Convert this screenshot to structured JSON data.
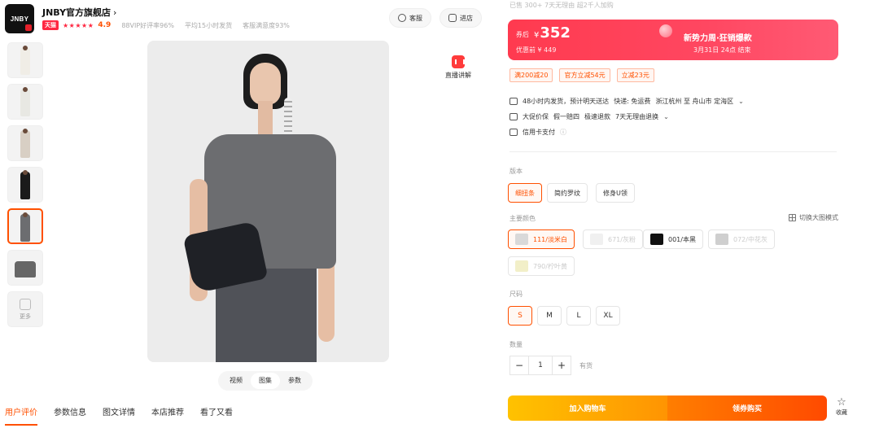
{
  "store": {
    "logo_text": "JNBY",
    "name": "JNBY官方旗舰店",
    "chevron": "›",
    "tmall_badge": "天猫",
    "stars": "★★★★★",
    "rating": "4.9",
    "stats": [
      "88VIP好评率96%",
      "平均15小时发货",
      "客服满意度93%"
    ]
  },
  "header_buttons": {
    "service": "客服",
    "shop": "进店"
  },
  "live": {
    "label": "直播讲解"
  },
  "thumbnails": {
    "more_label": "更多",
    "items": [
      {
        "kind": "model",
        "color": "#f0ede6"
      },
      {
        "kind": "model",
        "color": "#f2f2f0"
      },
      {
        "kind": "model",
        "color": "#efece4"
      },
      {
        "kind": "model",
        "color": "#1a1a1a"
      },
      {
        "kind": "model",
        "color": "#6c6d70",
        "active": true
      },
      {
        "kind": "tee",
        "color": "#5d5e61"
      }
    ]
  },
  "view_tabs": [
    "视频",
    "图集",
    "参数"
  ],
  "view_tab_active": 1,
  "bottom_tabs": [
    "用户评价",
    "参数信息",
    "图文详情",
    "本店推荐",
    "看了又看"
  ],
  "bottom_tab_active": 0,
  "price": {
    "top_partial": "已售 300+ 7天无理由 超2千人加购",
    "label": "券后",
    "currency": "¥",
    "value": "352",
    "sub": "优惠前 ¥ 449",
    "promo_title": "新势力周·狂销爆款",
    "promo_time": "3月31日 24点 结束"
  },
  "coupons": [
    "满200减20",
    "官方立减54元",
    "立减23元"
  ],
  "services": [
    {
      "icon": "truck-icon",
      "text": "48小时内发货，预计明天送达",
      "extra": "快递: 免运费",
      "route": "浙江杭州 至 舟山市 定海区",
      "chevron": "⌄"
    },
    {
      "icon": "shield-icon",
      "text": "大促价保",
      "extra": "假一赔四",
      "route": "极速退款",
      "extra2": "7天无理由退换",
      "chevron": "⌄"
    },
    {
      "icon": "card-icon",
      "text": "信用卡支付",
      "info": "ⓘ"
    }
  ],
  "version": {
    "label": "版本",
    "options": [
      "细扭条",
      "简约罗纹",
      "修身U领"
    ],
    "selected": 0
  },
  "color": {
    "label": "主要颜色",
    "toggle": "切换大图模式",
    "options": [
      {
        "label": "111/淡米白",
        "swatch": "#d9d9d9",
        "state": "selected"
      },
      {
        "label": "671/灰粉",
        "swatch": "#f0f0f0",
        "state": "disabled"
      },
      {
        "label": "001/本黑",
        "swatch": "#111111",
        "state": "normal"
      },
      {
        "label": "072/中花灰",
        "swatch": "#cfcfcf",
        "state": "disabled"
      },
      {
        "label": "790/柠叶黄",
        "swatch": "#f2efc8",
        "state": "disabled"
      }
    ]
  },
  "size": {
    "label": "尺码",
    "options": [
      "S",
      "M",
      "L",
      "XL"
    ],
    "selected": 0
  },
  "quantity": {
    "label": "数量",
    "minus": "−",
    "value": "1",
    "plus": "+",
    "stock": "有货"
  },
  "actions": {
    "cart": "加入购物车",
    "buy": "领券购买",
    "favorite": "收藏",
    "favorite_icon": "☆"
  }
}
